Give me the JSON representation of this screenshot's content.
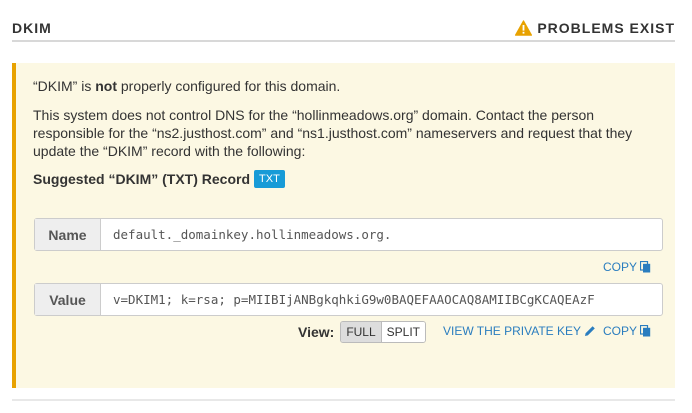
{
  "header": {
    "title": "DKIM",
    "status": "PROBLEMS EXIST",
    "status_icon": "warning-triangle-icon",
    "status_color": "#e8a200"
  },
  "alert": {
    "line1_pre": "“DKIM” is ",
    "line1_bold": "not",
    "line1_post": " properly configured for this domain.",
    "paragraph": "This system does not control DNS for the “hollinmeadows.org” domain. Contact the person responsible for the “ns2.justhost.com” and “ns1.justhost.com” nameservers and request that they update the “DKIM” record with the following:",
    "suggested_label": "Suggested “DKIM” (TXT) Record",
    "badge": "TXT",
    "badge_color": "#179bd7",
    "background": "#fcf8e3",
    "border_color": "#e8a200"
  },
  "record": {
    "name_label": "Name",
    "name_value": "default._domainkey.hollinmeadows.org.",
    "value_label": "Value",
    "value_value": "v=DKIM1; k=rsa; p=MIIBIjANBgkqhkiG9w0BAQEFAAOCAQ8AMIIBCgKCAQEAzF"
  },
  "actions": {
    "copy": "COPY",
    "view_label": "View:",
    "full": "FULL",
    "split": "SPLIT",
    "view_private_key": "VIEW THE PRIVATE KEY",
    "copy_icon": "clipboard-icon",
    "pencil_icon": "pencil-icon",
    "link_color": "#2a7dbf"
  }
}
